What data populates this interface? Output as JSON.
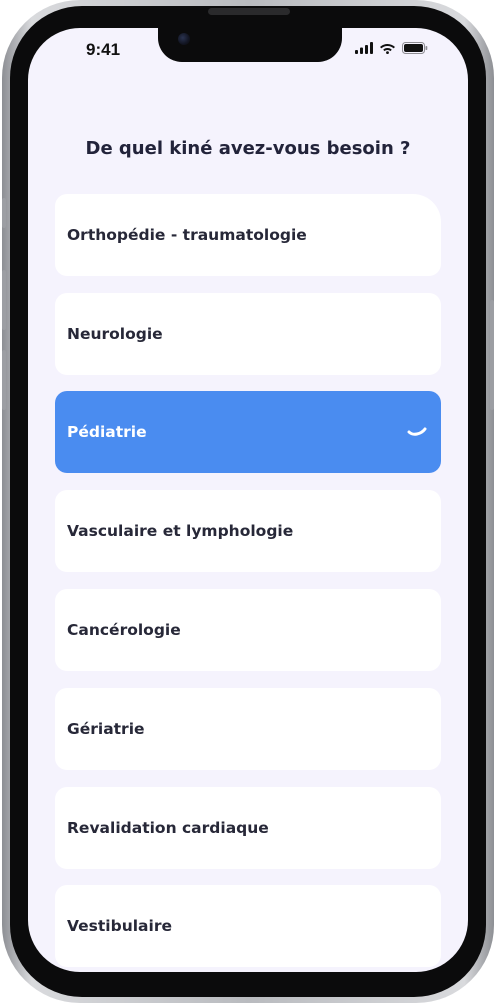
{
  "status_bar": {
    "time": "9:41",
    "icons": [
      "cellular-signal-icon",
      "wifi-icon",
      "battery-icon"
    ]
  },
  "screen": {
    "title": "De quel kiné avez-vous besoin ?",
    "options": [
      {
        "label": "Orthopédie - traumatologie",
        "selected": false
      },
      {
        "label": "Neurologie",
        "selected": false
      },
      {
        "label": "Pédiatrie",
        "selected": true
      },
      {
        "label": "Vasculaire et lymphologie",
        "selected": false
      },
      {
        "label": "Cancérologie",
        "selected": false
      },
      {
        "label": "Gériatrie",
        "selected": false
      },
      {
        "label": "Revalidation cardiaque",
        "selected": false
      },
      {
        "label": "Vestibulaire",
        "selected": false
      }
    ]
  },
  "colors": {
    "background": "#f5f3fd",
    "card": "#ffffff",
    "selected": "#4a8cf0",
    "text": "#272838"
  }
}
